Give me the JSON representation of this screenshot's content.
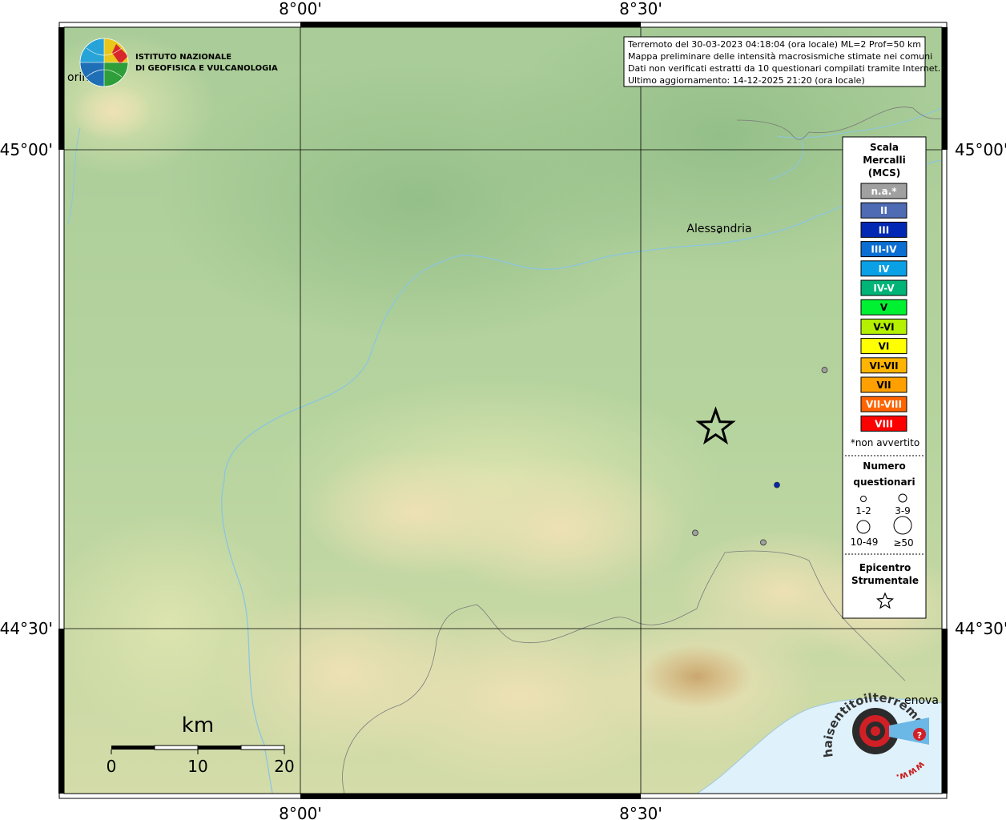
{
  "map": {
    "header_lines": [
      "Terremoto del 30-03-2023 04:18:04 (ora locale) ML=2 Prof=50 km",
      "Mappa preliminare delle intensità macrosismiche stimate nei comuni",
      "Dati non verificati estratti da 10 questionari compilati tramite Internet.",
      "Ultimo aggiornamento: 14-12-2025 21:20 (ora locale)"
    ],
    "lon_labels": [
      "8°00'",
      "8°30'"
    ],
    "lat_labels": [
      "45°00'",
      "44°30'"
    ],
    "cities": [
      {
        "name": "Alessandria"
      },
      {
        "name": "Torino",
        "shown": "orin"
      },
      {
        "name": "Genova",
        "shown": "enova"
      }
    ],
    "ingv_logo": {
      "line1": "ISTITUTO NAZIONALE",
      "line2": "DI GEOFISICA E VULCANOLOGIA"
    },
    "hsit_logo": {
      "top_text": "haisentitoilterremoto.it",
      "bottom_text": "www."
    },
    "scale_bar": {
      "unit": "km",
      "ticks": [
        "0",
        "10",
        "20"
      ]
    },
    "epicenter": {
      "lat": 44.71,
      "lon": 8.61
    },
    "observations": [
      {
        "lat": 44.65,
        "lon": 8.7,
        "intensity": "III",
        "color": "#0028b4"
      },
      {
        "lat": 44.6,
        "lon": 8.58,
        "intensity": "n.a.",
        "color": "#a0a0a0"
      },
      {
        "lat": 44.59,
        "lon": 8.68,
        "intensity": "n.a.",
        "color": "#a0a0a0"
      },
      {
        "lat": 44.77,
        "lon": 8.77,
        "intensity": "n.a.",
        "color": "#a0a0a0"
      }
    ]
  },
  "legend": {
    "title_lines": [
      "Scala",
      "Mercalli",
      "(MCS)"
    ],
    "scale": [
      {
        "label": "n.a.*",
        "color": "#a0a0a0"
      },
      {
        "label": "II",
        "color": "#4e6bb4"
      },
      {
        "label": "III",
        "color": "#0028b4"
      },
      {
        "label": "III-IV",
        "color": "#0a6ed2"
      },
      {
        "label": "IV",
        "color": "#0aa0e6"
      },
      {
        "label": "IV-V",
        "color": "#00b478"
      },
      {
        "label": "V",
        "color": "#00f032"
      },
      {
        "label": "V-VI",
        "color": "#b4f000"
      },
      {
        "label": "VI",
        "color": "#ffff00"
      },
      {
        "label": "VI-VII",
        "color": "#ffb400"
      },
      {
        "label": "VII",
        "color": "#ffa000"
      },
      {
        "label": "VII-VIII",
        "color": "#ff6400"
      },
      {
        "label": "VIII",
        "color": "#ff0000"
      }
    ],
    "na_note": "*non avvertito",
    "questionnaires_title": [
      "Numero",
      "questionari"
    ],
    "questionnaire_sizes": [
      "1-2",
      "3-9",
      "10-49",
      "≥50"
    ],
    "epicenter_title": [
      "Epicentro",
      "Strumentale"
    ]
  }
}
